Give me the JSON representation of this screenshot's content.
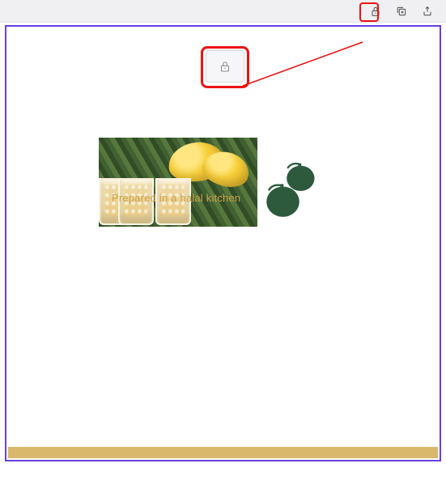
{
  "toolbar": {
    "lock_icon": "lock-icon",
    "duplicate_icon": "duplicate-icon",
    "export_icon": "export-icon"
  },
  "canvas": {
    "lock_overlay_icon": "lock-icon",
    "image_caption": "Prepared in a halal kitchen"
  },
  "colors": {
    "selection_border": "#6a3fe0",
    "highlight": "#e11",
    "logo_green": "#2d5a3d",
    "accent_gold": "#d9b86b"
  }
}
